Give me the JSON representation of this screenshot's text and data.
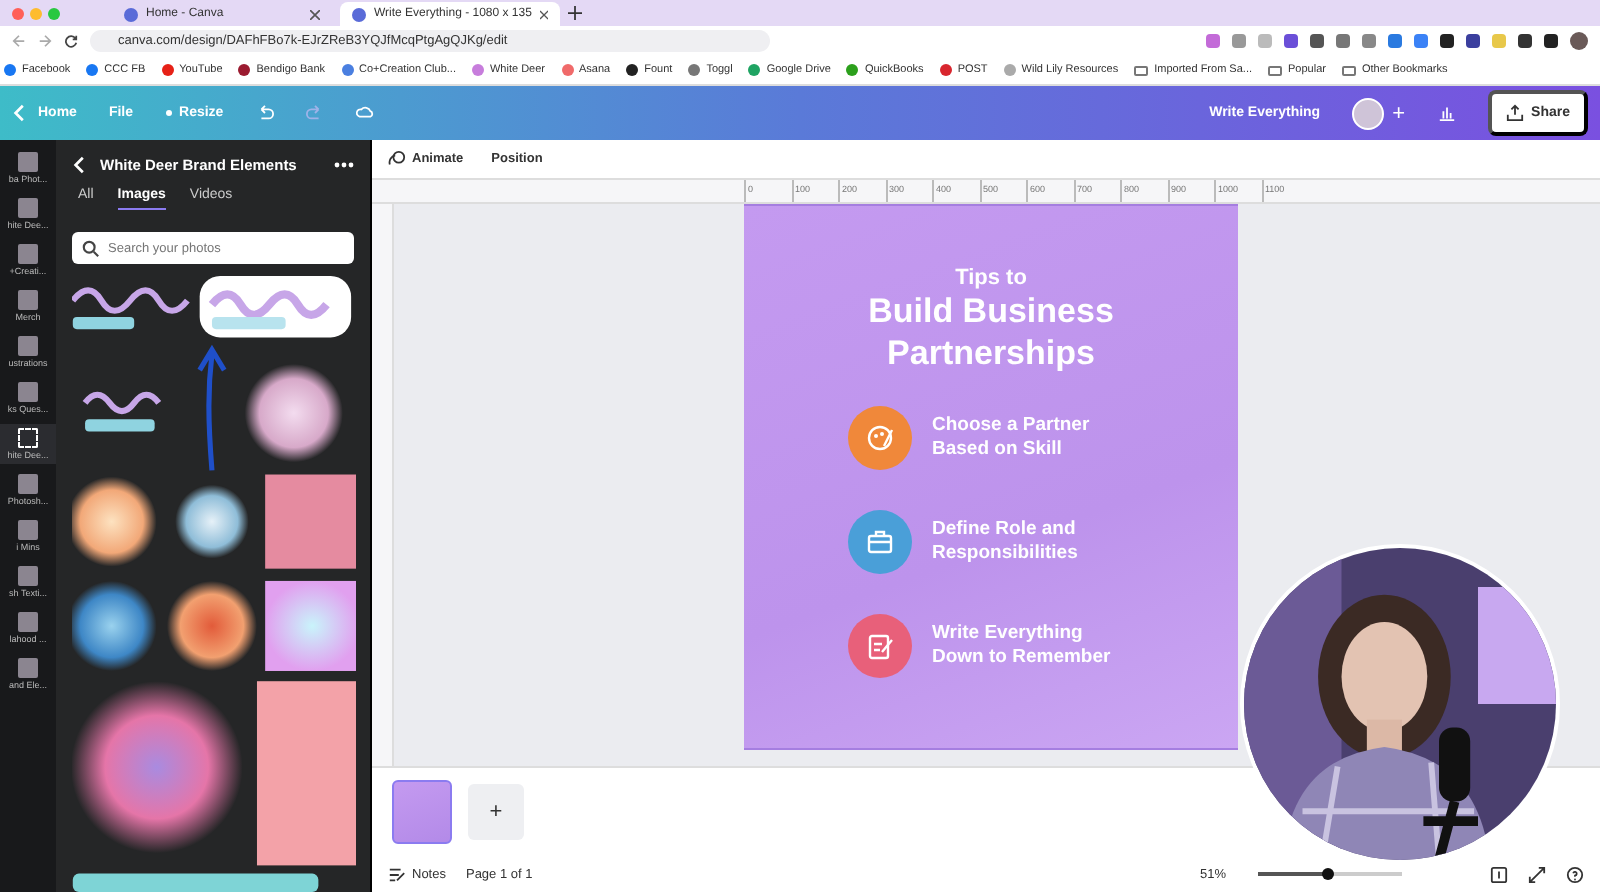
{
  "browser": {
    "tabs": [
      {
        "title": "Home - Canva",
        "selected": false
      },
      {
        "title": "Write Everything - 1080 x 135",
        "selected": true
      }
    ],
    "url": "canva.com/design/DAFhFBo7k-EJrZReB3YQJfMcqPtgAgQJKg/edit",
    "bookmarks": [
      {
        "label": "Facebook",
        "kind": "site",
        "color": "#1877f2"
      },
      {
        "label": "CCC FB",
        "kind": "site",
        "color": "#1877f2"
      },
      {
        "label": "YouTube",
        "kind": "site",
        "color": "#e62117"
      },
      {
        "label": "Bendigo Bank",
        "kind": "site",
        "color": "#9b1b30"
      },
      {
        "label": "Co+Creation Club...",
        "kind": "site",
        "color": "#4a7fe0"
      },
      {
        "label": "White Deer",
        "kind": "site",
        "color": "#c77ddc"
      },
      {
        "label": "Asana",
        "kind": "site",
        "color": "#f06a6a"
      },
      {
        "label": "Fount",
        "kind": "site",
        "color": "#222222"
      },
      {
        "label": "Toggl",
        "kind": "site",
        "color": "#777777"
      },
      {
        "label": "Google Drive",
        "kind": "site",
        "color": "#1fa463"
      },
      {
        "label": "QuickBooks",
        "kind": "site",
        "color": "#2ca01c"
      },
      {
        "label": "POST",
        "kind": "site",
        "color": "#d8262e"
      },
      {
        "label": "Wild Lily Resources",
        "kind": "site",
        "color": "#aaaaaa"
      },
      {
        "label": "Imported From Sa...",
        "kind": "folder"
      },
      {
        "label": "Popular",
        "kind": "folder"
      },
      {
        "label": "Other Bookmarks",
        "kind": "folder"
      }
    ]
  },
  "topbar": {
    "menu": [
      {
        "label": "Home",
        "kind": "back"
      },
      {
        "label": "File",
        "kind": "plain"
      },
      {
        "label": "Resize",
        "kind": "resize"
      }
    ],
    "design_title": "Write Everything",
    "add": "+",
    "share": "Share"
  },
  "rail": [
    {
      "label": "ba Phot...",
      "selected": false
    },
    {
      "label": "hite Dee...",
      "selected": false
    },
    {
      "label": "+Creati...",
      "selected": false
    },
    {
      "label": "Merch",
      "selected": false
    },
    {
      "label": "ustrations",
      "selected": false
    },
    {
      "label": "ks Ques...",
      "selected": false
    },
    {
      "label": "hite Dee...",
      "selected": true
    },
    {
      "label": "Photosh...",
      "selected": false
    },
    {
      "label": "i Mins",
      "selected": false
    },
    {
      "label": "sh Texti...",
      "selected": false
    },
    {
      "label": "lahood ...",
      "selected": false
    },
    {
      "label": "and Ele...",
      "selected": false
    }
  ],
  "panel": {
    "title": "White Deer Brand Elements",
    "tabs": [
      {
        "label": "All",
        "selected": false
      },
      {
        "label": "Images",
        "selected": true
      },
      {
        "label": "Videos",
        "selected": false
      }
    ],
    "search": {
      "placeholder": "Search your photos"
    }
  },
  "toolbar": [
    {
      "label": "Animate",
      "kind": "animate"
    },
    {
      "label": "Position",
      "kind": "plain"
    }
  ],
  "ruler": [
    "0",
    "100",
    "200",
    "300",
    "400",
    "500",
    "600",
    "700",
    "800",
    "900",
    "1000",
    "1100"
  ],
  "design": {
    "kicker": "Tips to",
    "title_lines": [
      "Build Business",
      "Partnerships"
    ],
    "tips": [
      {
        "text": "Choose a Partner Based on Skill",
        "kind": "palette",
        "color": "#f0883a"
      },
      {
        "text": "Define Role and Responsibilities",
        "kind": "briefcase",
        "color": "#4a9fd8"
      },
      {
        "text": "Write Everything Down to Remember",
        "kind": "note",
        "color": "#e8607a"
      }
    ]
  },
  "pages": {
    "add": "+"
  },
  "footer": {
    "notes": "Notes",
    "page": "Page 1 of 1",
    "zoom": "51%",
    "level": 0.49
  }
}
